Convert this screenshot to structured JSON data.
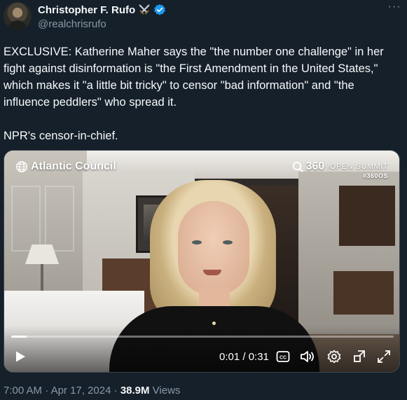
{
  "author": {
    "display_name": "Christopher F. Rufo",
    "handle": "@realchrisrufo",
    "emoji_icon": "crossed-swords-icon",
    "verified_icon": "verified-badge-icon"
  },
  "tweet": {
    "text": "EXCLUSIVE: Katherine Maher says the \"the number one challenge\" in her fight against disinformation is \"the First Amendment in the United States,\" which makes it \"a little bit tricky\" to censor \"bad information\" and \"the influence peddlers\" who spread it.\n\nNPR's censor-in-chief."
  },
  "video": {
    "brand_left": "Atlantic Council",
    "summit_number": "360",
    "summit_name": "/OPEN SUMMIT",
    "summit_hashtag": "#360OS",
    "time": "0:01 / 0:31",
    "progress_fraction": 0.04
  },
  "meta": {
    "time": "7:00 AM",
    "separator1": " · ",
    "date": "Apr 17, 2024",
    "separator2": " · ",
    "views_count": "38.9M",
    "views_label": " Views"
  },
  "colors": {
    "background": "#15202b",
    "text": "#f7f9f9",
    "secondary": "#8b98a5",
    "verified": "#1d9bf0"
  }
}
